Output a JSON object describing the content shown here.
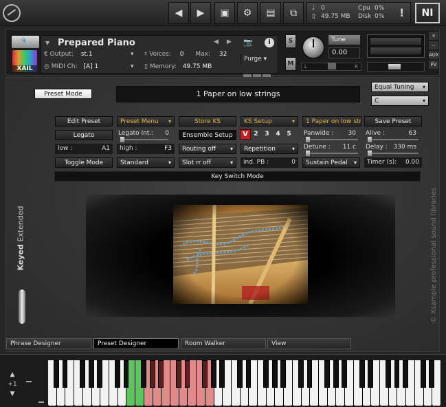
{
  "toolbar": {
    "voices_count": "0",
    "memory": "49.75 MB",
    "cpu_label": "Cpu",
    "cpu_value": "0%",
    "disk_label": "Disk",
    "disk_value": "0%",
    "alert_glyph": "!",
    "ni_logo": "NI",
    "icons": [
      "kontakt-logo-icon",
      "prev-arrow-icon",
      "next-arrow-icon",
      "save-icon",
      "gear-icon",
      "view-icon",
      "resize-icon",
      "voices-icon",
      "memory-icon",
      "alert-icon"
    ]
  },
  "instrument": {
    "title": "Prepared Piano",
    "output_label": "Output:",
    "output_value": "st.1",
    "midi_label": "MIDI Ch:",
    "midi_value": "[A]  1",
    "voices_label": "Voices:",
    "voices_value": "0",
    "max_label": "Max:",
    "max_value": "32",
    "memory_label": "Memory:",
    "memory_value": "49.75 MB",
    "purge_label": "Purge",
    "s_button": "S",
    "m_button": "M",
    "tune_label": "Tune",
    "tune_value": "0.00",
    "pan_left": "L",
    "pan_right": "R",
    "aux_label": "AUX",
    "pv_label": "PV",
    "close_glyph": "×",
    "minimize_glyph": "–",
    "logo_text": "XAIL"
  },
  "main": {
    "preset_mode": "Preset Mode",
    "patch_name": "1 Paper on low strings",
    "tuning": "Equal Tuning",
    "key": "C",
    "row1": [
      "Edit Preset",
      "Preset Menu",
      "Store KS",
      "KS Setup",
      "1 Paper on low stri",
      "Save Preset"
    ],
    "legato": "Legato",
    "legato_int_label": "Legato Int.:",
    "legato_int_value": "0",
    "ensemble_setup": "Ensemble Setup",
    "v_button": "V",
    "numbers": [
      "2",
      "3",
      "4",
      "5"
    ],
    "panwide_label": "Panwide :",
    "panwide_value": "30",
    "alive_label": "Alive :",
    "alive_value": "63",
    "low_label": "low :",
    "low_value": "A1",
    "high_label": "high :",
    "high_value": "F3",
    "routing": "Routing off",
    "repetition": "Repetition",
    "detune_label": "Detune :",
    "detune_value": "11 c",
    "delay_label": "Delay :",
    "delay_value": "330 ms",
    "toggle_mode": "Toggle Mode",
    "standard": "Standard",
    "slot_rr": "Slot rr off",
    "ind_pb_label": "ind. PB :",
    "ind_pb_value": "0",
    "sustain_pedal": "Sustain Pedal",
    "timer_label": "Timer (s):",
    "timer_value": "0.00",
    "keyswitch_mode": "Key Switch Mode",
    "side_keyed": "Keyed",
    "side_extended": "Extended",
    "xsample_text": "© Xsample professional sound libraries"
  },
  "tabs": [
    {
      "label": "Phrase Designer",
      "active": false
    },
    {
      "label": "Preset Designer",
      "active": true
    },
    {
      "label": "Room Walker",
      "active": false
    },
    {
      "label": "View",
      "active": false
    }
  ],
  "keyboard": {
    "octave_up": "▲",
    "octave_value": "+1",
    "octave_down": "▼",
    "colors": {
      "keyswitch": "#5ec55e",
      "range": "#e08a8a",
      "white": "#f2f2f2",
      "black": "#111111"
    }
  }
}
